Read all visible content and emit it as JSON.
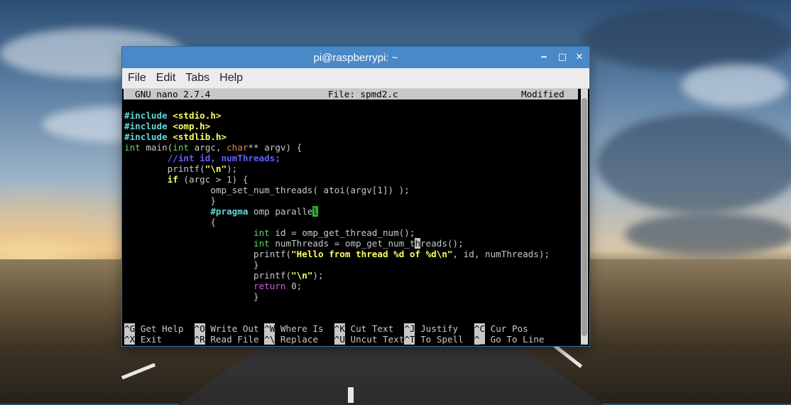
{
  "window": {
    "title": "pi@raspberrypi: ~",
    "controls": {
      "minimize": "‒",
      "maximize": "□",
      "close": "✕"
    }
  },
  "menu": [
    "File",
    "Edit",
    "Tabs",
    "Help"
  ],
  "nano": {
    "version": "GNU nano 2.7.4",
    "file": "File: spmd2.c",
    "state": "Modified"
  },
  "code": [
    "#include <stdio.h>",
    "#include <omp.h>",
    "#include <stdlib.h>",
    "int main(int argc, char** argv) {",
    "        //int id, numThreads;",
    "        printf(\"\\n\");",
    "        if (argc > 1) {",
    "                omp_set_num_threads( atoi(argv[1]) );",
    "                }",
    "                #pragma omp parallel",
    "                {",
    "                        int id = omp_get_thread_num();",
    "                        int numThreads = omp_get_num_threads();",
    "                        printf(\"Hello from thread %d of %d\\n\", id, numThreads);",
    "                        }",
    "                        printf(\"\\n\");",
    "                        return 0;",
    "                        }"
  ],
  "shortcuts": [
    {
      "key": "^G",
      "label": "Get Help"
    },
    {
      "key": "^O",
      "label": "Write Out"
    },
    {
      "key": "^W",
      "label": "Where Is"
    },
    {
      "key": "^K",
      "label": "Cut Text"
    },
    {
      "key": "^J",
      "label": "Justify"
    },
    {
      "key": "^C",
      "label": "Cur Pos"
    },
    {
      "key": "^X",
      "label": "Exit"
    },
    {
      "key": "^R",
      "label": "Read File"
    },
    {
      "key": "^\\",
      "label": "Replace"
    },
    {
      "key": "^U",
      "label": "Uncut Text"
    },
    {
      "key": "^T",
      "label": "To Spell"
    },
    {
      "key": "^_",
      "label": "Go To Line"
    }
  ],
  "colors": {
    "titlebar": "#4a89c7",
    "keyword": "#5fd75f",
    "include": "#5fd7d7",
    "string": "#ffff5f",
    "comment": "#5f5fff",
    "return": "#d75fd7"
  }
}
